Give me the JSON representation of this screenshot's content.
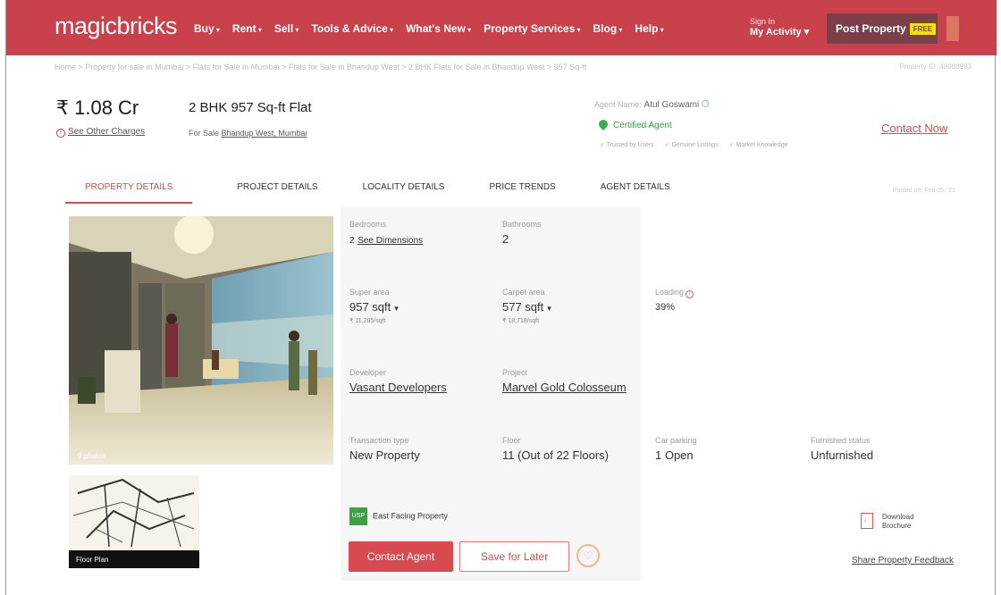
{
  "header": {
    "logo": "magicbricks",
    "nav": [
      "Buy",
      "Rent",
      "Sell",
      "Tools & Advice",
      "What's New",
      "Property Services",
      "Blog",
      "Help"
    ],
    "signin_small": "Sign In",
    "signin_main": "My Activity ▾",
    "post_label": "Post Property",
    "free_badge": "FREE",
    "brand_color": "#c8414b"
  },
  "breadcrumb": "Home  >  Property for sale in Mumbai  >  Flats for Sale in Mumbai  >  Flats for Sale in Bhandup West  >  2 BHK Flats for Sale in Bhandup West  >  957 Sq-ft",
  "property_id": "Property ID: 48088983",
  "summary": {
    "price": "₹ 1.08 Cr",
    "title": "2 BHK 957 Sq-ft Flat",
    "other_charges": "See Other Charges",
    "for_sale_prefix": "For Sale ",
    "location": "Bhandup West, Mumbai"
  },
  "agent": {
    "label": "Agent Name:",
    "name": "Atul Goswami",
    "certified": "Certified Agent",
    "traits": [
      "Trusted by Users",
      "Genuine Listings",
      "Market Knowledge"
    ],
    "contact_now": "Contact Now"
  },
  "tabs": [
    "PROPERTY DETAILS",
    "PROJECT DETAILS",
    "LOCALITY DETAILS",
    "PRICE TRENDS",
    "AGENT DETAILS"
  ],
  "posted_on": "Posted on: Feb 05, '21",
  "media": {
    "photo_count": "9 photos",
    "floor_plan": "Floor Plan"
  },
  "details": {
    "bedrooms_label": "Bedrooms",
    "bedrooms_value": "2",
    "see_dimensions": "See Dimensions",
    "bathrooms_label": "Bathrooms",
    "bathrooms_value": "2",
    "super_area_label": "Super area",
    "super_area_value": "957 sqft",
    "super_area_rate": "₹ 11,285/sqft",
    "carpet_area_label": "Carpet area",
    "carpet_area_value": "577 sqft",
    "carpet_area_rate": "₹ 18,718/sqft",
    "loading_label": "Loading",
    "loading_value": "39%",
    "developer_label": "Developer",
    "developer_value": "Vasant Developers",
    "project_label": "Project",
    "project_value": "Marvel Gold Colosseum",
    "transaction_label": "Transaction type",
    "transaction_value": "New Property",
    "floor_label": "Floor",
    "floor_value": "11 (Out of 22 Floors)",
    "parking_label": "Car parking",
    "parking_value": "1 Open",
    "furnished_label": "Furnished status",
    "furnished_value": "Unfurnished"
  },
  "usp": {
    "badge": "USP",
    "text": "East Facing Property"
  },
  "actions": {
    "contact_agent": "Contact Agent",
    "save_for_later": "Save for Later",
    "download_line1": "Download",
    "download_line2": "Brochure",
    "share_feedback": "Share Property Feedback"
  }
}
